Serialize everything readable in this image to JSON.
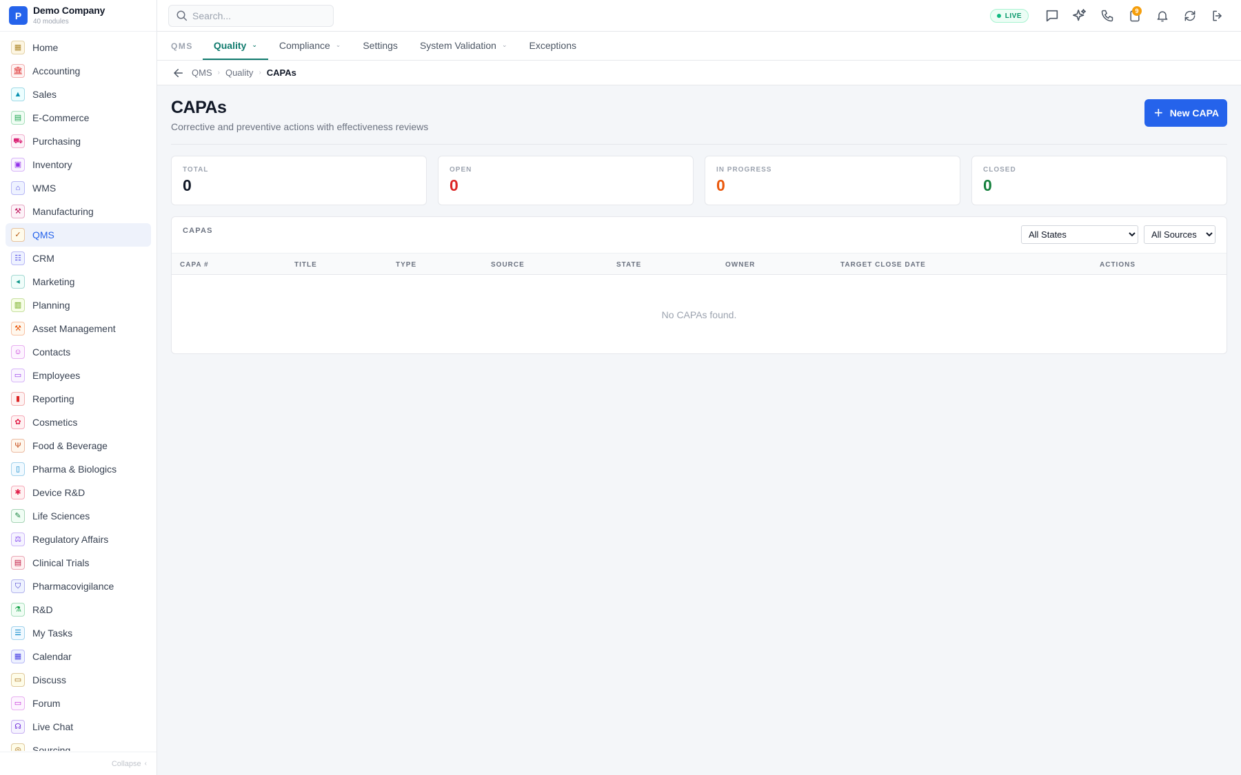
{
  "company": {
    "logo_letter": "P",
    "name": "Demo Company",
    "subtitle": "40 modules"
  },
  "sidebar": {
    "items": [
      {
        "label": "Home",
        "icon": "grid-icon",
        "glyph": "▦",
        "color": "#b08a2e",
        "bg": "#fdf6e3"
      },
      {
        "label": "Accounting",
        "icon": "bank-icon",
        "glyph": "🏛",
        "color": "#dc2626",
        "bg": "#fef2f2"
      },
      {
        "label": "Sales",
        "icon": "flask-icon",
        "glyph": "▲",
        "color": "#0891b2",
        "bg": "#ecfeff"
      },
      {
        "label": "E-Commerce",
        "icon": "store-icon",
        "glyph": "▤",
        "color": "#16a34a",
        "bg": "#f0fdf4"
      },
      {
        "label": "Purchasing",
        "icon": "cart-icon",
        "glyph": "⛟",
        "color": "#db2777",
        "bg": "#fdf2f8"
      },
      {
        "label": "Inventory",
        "icon": "box-icon",
        "glyph": "▣",
        "color": "#9333ea",
        "bg": "#faf5ff"
      },
      {
        "label": "WMS",
        "icon": "warehouse-icon",
        "glyph": "⌂",
        "color": "#4f46e5",
        "bg": "#eef2ff"
      },
      {
        "label": "Manufacturing",
        "icon": "factory-icon",
        "glyph": "⚒",
        "color": "#be185d",
        "bg": "#fdf2f8"
      },
      {
        "label": "QMS",
        "icon": "badge-check-icon",
        "glyph": "✓",
        "color": "#b45309",
        "bg": "#fffbeb"
      },
      {
        "label": "CRM",
        "icon": "users-icon",
        "glyph": "☷",
        "color": "#4f46e5",
        "bg": "#eef2ff"
      },
      {
        "label": "Marketing",
        "icon": "megaphone-icon",
        "glyph": "◂",
        "color": "#0d9488",
        "bg": "#f0fdfa"
      },
      {
        "label": "Planning",
        "icon": "clipboard-icon",
        "glyph": "▥",
        "color": "#65a30d",
        "bg": "#f7fee7"
      },
      {
        "label": "Asset Management",
        "icon": "tools-icon",
        "glyph": "⚒",
        "color": "#ea580c",
        "bg": "#fff7ed"
      },
      {
        "label": "Contacts",
        "icon": "contact-icon",
        "glyph": "☺",
        "color": "#c026d3",
        "bg": "#fdf4ff"
      },
      {
        "label": "Employees",
        "icon": "briefcase-icon",
        "glyph": "▭",
        "color": "#9333ea",
        "bg": "#faf5ff"
      },
      {
        "label": "Reporting",
        "icon": "bar-chart-icon",
        "glyph": "▮",
        "color": "#dc2626",
        "bg": "#fef2f2"
      },
      {
        "label": "Cosmetics",
        "icon": "flower-icon",
        "glyph": "✿",
        "color": "#e11d48",
        "bg": "#fff1f2"
      },
      {
        "label": "Food & Beverage",
        "icon": "utensils-icon",
        "glyph": "Ψ",
        "color": "#c2410c",
        "bg": "#fff7ed"
      },
      {
        "label": "Pharma & Biologics",
        "icon": "pill-bottle-icon",
        "glyph": "▯",
        "color": "#0284c7",
        "bg": "#f0f9ff"
      },
      {
        "label": "Device R&D",
        "icon": "cog-icon",
        "glyph": "✱",
        "color": "#e11d48",
        "bg": "#fff1f2"
      },
      {
        "label": "Life Sciences",
        "icon": "microscope-icon",
        "glyph": "✎",
        "color": "#15803d",
        "bg": "#f0fdf4"
      },
      {
        "label": "Regulatory Affairs",
        "icon": "gavel-icon",
        "glyph": "⚖",
        "color": "#7c3aed",
        "bg": "#f5f3ff"
      },
      {
        "label": "Clinical Trials",
        "icon": "clipboard-check-icon",
        "glyph": "▤",
        "color": "#be123c",
        "bg": "#fff1f2"
      },
      {
        "label": "Pharmacovigilance",
        "icon": "shield-icon",
        "glyph": "⛉",
        "color": "#4338ca",
        "bg": "#eef2ff"
      },
      {
        "label": "R&D",
        "icon": "beaker-icon",
        "glyph": "⚗",
        "color": "#16a34a",
        "bg": "#f0fdf4"
      },
      {
        "label": "My Tasks",
        "icon": "checklist-icon",
        "glyph": "☰",
        "color": "#0284c7",
        "bg": "#f0f9ff"
      },
      {
        "label": "Calendar",
        "icon": "calendar-icon",
        "glyph": "▦",
        "color": "#4f46e5",
        "bg": "#eef2ff"
      },
      {
        "label": "Discuss",
        "icon": "chat-bubbles-icon",
        "glyph": "▭",
        "color": "#a16207",
        "bg": "#fefce8"
      },
      {
        "label": "Forum",
        "icon": "forum-icon",
        "glyph": "▭",
        "color": "#c026d3",
        "bg": "#fdf4ff"
      },
      {
        "label": "Live Chat",
        "icon": "headset-icon",
        "glyph": "☊",
        "color": "#6d28d9",
        "bg": "#f5f3ff"
      },
      {
        "label": "Sourcing",
        "icon": "target-icon",
        "glyph": "◎",
        "color": "#a16207",
        "bg": "#fefce8"
      }
    ],
    "active_index": 8,
    "collapse_label": "Collapse"
  },
  "topbar": {
    "search_placeholder": "Search...",
    "live_label": "LIVE",
    "icons": [
      "chat-icon",
      "sparkles-icon",
      "phone-icon",
      "clipboard-alert-icon",
      "bell-icon",
      "refresh-icon",
      "logout-icon"
    ],
    "badge_count": "9"
  },
  "modbar": {
    "module_name": "QMS",
    "tabs": [
      {
        "label": "Quality",
        "dropdown": true,
        "active": true
      },
      {
        "label": "Compliance",
        "dropdown": true,
        "active": false
      },
      {
        "label": "Settings",
        "dropdown": false,
        "active": false
      },
      {
        "label": "System Validation",
        "dropdown": true,
        "active": false
      },
      {
        "label": "Exceptions",
        "dropdown": false,
        "active": false
      }
    ]
  },
  "breadcrumb": [
    "QMS",
    "Quality",
    "CAPAs"
  ],
  "page": {
    "title": "CAPAs",
    "subtitle": "Corrective and preventive actions with effectiveness reviews",
    "new_button": "New CAPA"
  },
  "stats": [
    {
      "label": "TOTAL",
      "value": "0",
      "color": "#111827"
    },
    {
      "label": "OPEN",
      "value": "0",
      "color": "#dc2626"
    },
    {
      "label": "IN PROGRESS",
      "value": "0",
      "color": "#ea580c"
    },
    {
      "label": "CLOSED",
      "value": "0",
      "color": "#15803d"
    }
  ],
  "table": {
    "title": "CAPAS",
    "filters": [
      {
        "name": "state-filter",
        "selected": "All States"
      },
      {
        "name": "source-filter",
        "selected": "All Sources"
      }
    ],
    "columns": [
      {
        "label": "CAPA #",
        "align": "left"
      },
      {
        "label": "TITLE",
        "align": "left"
      },
      {
        "label": "TYPE",
        "align": "left"
      },
      {
        "label": "SOURCE",
        "align": "left"
      },
      {
        "label": "STATE",
        "align": "left"
      },
      {
        "label": "OWNER",
        "align": "left"
      },
      {
        "label": "TARGET CLOSE DATE",
        "align": "left"
      },
      {
        "label": "ACTIONS",
        "align": "right"
      }
    ],
    "empty_text": "No CAPAs found."
  },
  "colors": {
    "accent": "#2563eb",
    "tab_active": "#0f7a6d",
    "live": "#10b981",
    "badge": "#f59e0b"
  }
}
